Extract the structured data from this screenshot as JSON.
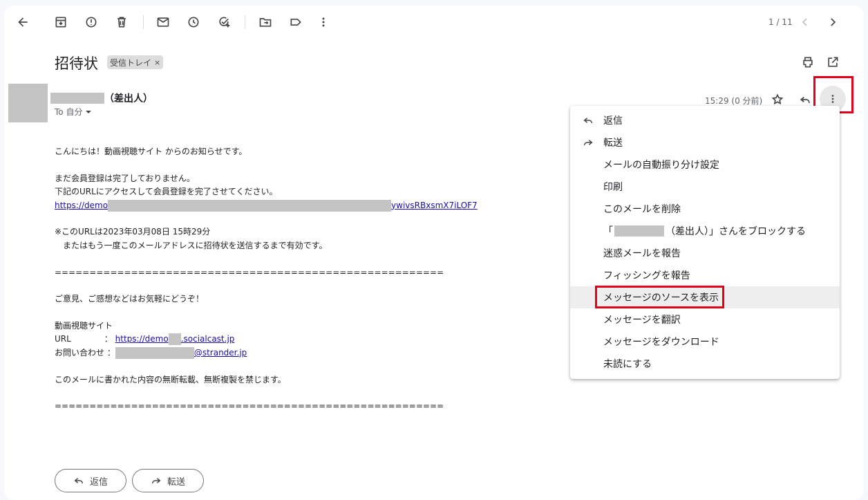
{
  "toolbar": {
    "back": "arrow-back-icon",
    "archive": "archive-icon",
    "report_spam": "report-spam-icon",
    "delete": "delete-icon",
    "mark_unread": "mail-icon",
    "snooze": "snooze-clock-icon",
    "add_task": "add-task-icon",
    "move_to": "move-to-folder-icon",
    "labels": "label-icon",
    "more": "more-vert-icon",
    "counter": "1 / 11",
    "prev": "chevron-left-icon",
    "next": "chevron-right-icon"
  },
  "message": {
    "subject": "招待状",
    "label_chip": "受信トレイ",
    "label_remove": "×",
    "sender_suffix": "（差出人）",
    "to_line": "To 自分",
    "time": "15:29 (0 分前)"
  },
  "body": {
    "greeting": "こんにちは！動画視聴サイト からのお知らせです。",
    "line2": "まだ会員登録は完了しておりません。",
    "line3": "下記のURLにアクセスして会員登録を完了させてください。",
    "url_start": "https://demo",
    "url_end": "ywivsRBxsmX7iLOF7",
    "expire1": "※このURLは2023年03月08日 15時29分",
    "expire2": "　またはもう一度このメールアドレスに招待状を送信するまで有効です。",
    "divider": "========================================================",
    "feedback": "ご意見、ご感想などはお気軽にどうぞ！",
    "site_name": "動画視聴サイト",
    "url_label": "URL　　　　：",
    "site_url_start": "https://demo",
    "site_url_end": ".socialcast.jp",
    "inquiry_label": "お問い合わせ ：",
    "inquiry_end": "@strander.jp",
    "copyright": "このメールに書かれた内容の無断転載、無断複製を禁じます。",
    "divider2": "========================================================"
  },
  "menu": {
    "items": [
      {
        "label": "返信",
        "icon": "reply-icon"
      },
      {
        "label": "転送",
        "icon": "forward-icon"
      },
      {
        "label": "メールの自動振り分け設定"
      },
      {
        "label": "印刷"
      },
      {
        "label": "このメールを削除"
      },
      {
        "label_prefix": "「",
        "label_suffix": "（差出人）」さんをブロックする"
      },
      {
        "label": "迷惑メールを報告"
      },
      {
        "label": "フィッシングを報告"
      },
      {
        "label": "メッセージのソースを表示"
      },
      {
        "label": "メッセージを翻訳"
      },
      {
        "label": "メッセージをダウンロード"
      },
      {
        "label": "未読にする"
      }
    ]
  },
  "footer": {
    "reply_label": "返信",
    "forward_label": "転送"
  },
  "colors": {
    "highlight": "#e2001a",
    "link": "#1a0dab",
    "redaction": "#c4c4c4"
  }
}
